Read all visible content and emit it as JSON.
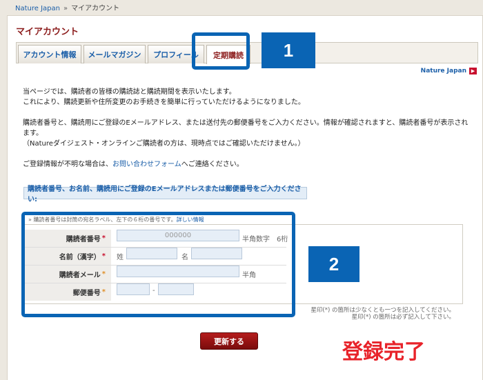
{
  "breadcrumb": {
    "home": "Nature Japan",
    "sep": "»",
    "current": "マイアカウント"
  },
  "page_title": "マイアカウント",
  "tabs": [
    {
      "label": "アカウント情報"
    },
    {
      "label": "メールマガジン"
    },
    {
      "label": "プロフィール"
    },
    {
      "label": "定期購読"
    }
  ],
  "nature_link": "Nature Japan",
  "intro": {
    "p1_line1": "当ページでは、購読者の皆様の購読誌と購読期間を表示いたします。",
    "p1_line2": "これにより、購読更新や住所変更のお手続きを簡単に行っていただけるようになりました。",
    "p2_line1": "購読者番号と、購読用にご登録のEメールアドレス、または送付先の郵便番号をご入力ください。情報が確認されますと、購読者番号が表示されます。",
    "p2_line2": "（Natureダイジェスト・オンラインご購読者の方は、現時点ではご確認いただけません。）",
    "p3_prefix": "ご登録情報が不明な場合は、",
    "p3_link": "お問い合わせフォーム",
    "p3_suffix": "へご連絡ください。"
  },
  "instruction": "購読者番号、お名前、購読用にご登録のEメールアドレスまたは郵便番号をご入力ください:",
  "form": {
    "hint_prefix": "» 購読者番号は封筒の宛名ラベル、左下の６桁の番号です。",
    "hint_link": "詳しい情報",
    "subscriber_number_label": "購読者番号",
    "subscriber_number_placeholder": "000000",
    "subscriber_number_note": "半角数字　6桁",
    "name_label": "名前（漢字）",
    "name_sei": "姓",
    "name_mei": "名",
    "email_label": "購読者メール",
    "email_note": "半角",
    "postal_label": "郵便番号",
    "postal_sep": "-",
    "required_mark": "*"
  },
  "legal_note1": "星印(*) の箇所は少なくとも一つを記入してください。",
  "legal_note2": "星印(*) の箇所は必ず記入して下さい。",
  "submit_label": "更新する",
  "callouts": {
    "one": "1",
    "two": "2"
  },
  "completion_text": "登録完了",
  "colors": {
    "accent": "#8c1c1c",
    "link": "#1a5ea8",
    "callout": "#0a64b4",
    "completion": "#e8232a"
  }
}
